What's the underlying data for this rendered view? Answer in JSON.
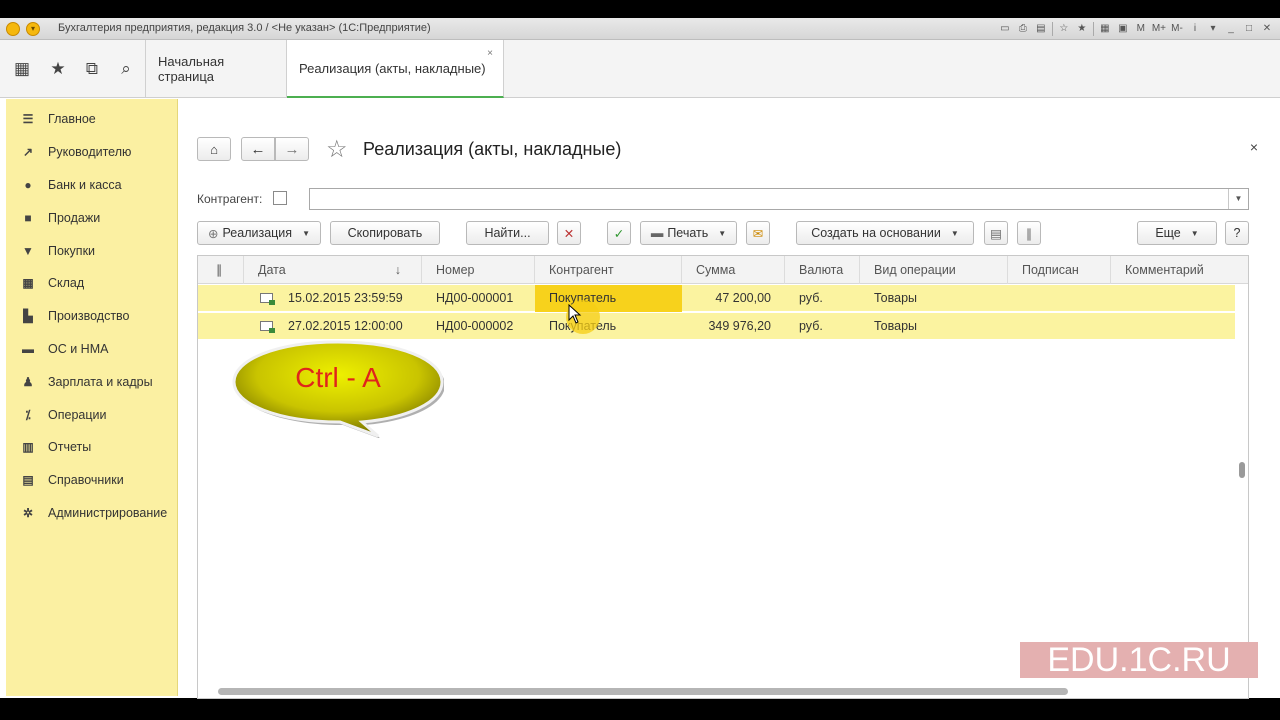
{
  "window": {
    "title": "Бухгалтерия предприятия, редакция 3.0 / <Не указан> (1С:Предприятие)"
  },
  "titlebar_tools": [
    "M",
    "M+",
    "M-",
    "i"
  ],
  "tabs": [
    {
      "label": "Начальная страница"
    },
    {
      "label": "Реализация (акты, накладные)",
      "close": "×"
    }
  ],
  "sidebar": {
    "items": [
      {
        "label": "Главное",
        "icon": "menu-icon"
      },
      {
        "label": "Руководителю",
        "icon": "chart-line-icon"
      },
      {
        "label": "Банк и касса",
        "icon": "coins-icon"
      },
      {
        "label": "Продажи",
        "icon": "bag-icon"
      },
      {
        "label": "Покупки",
        "icon": "cart-icon"
      },
      {
        "label": "Склад",
        "icon": "warehouse-icon"
      },
      {
        "label": "Производство",
        "icon": "factory-icon"
      },
      {
        "label": "ОС и НМА",
        "icon": "truck-icon"
      },
      {
        "label": "Зарплата и кадры",
        "icon": "person-icon"
      },
      {
        "label": "Операции",
        "icon": "operations-icon"
      },
      {
        "label": "Отчеты",
        "icon": "bar-chart-icon"
      },
      {
        "label": "Справочники",
        "icon": "book-icon"
      },
      {
        "label": "Администрирование",
        "icon": "gear-icon"
      }
    ]
  },
  "form": {
    "title": "Реализация (акты, накладные)",
    "close": "×",
    "counterparty_label": "Контрагент:",
    "counterparty_value": ""
  },
  "toolbar": {
    "realization": "Реализация",
    "copy": "Скопировать",
    "find": "Найти...",
    "print": "Печать",
    "create_based": "Создать на основании",
    "more": "Еще",
    "help": "?"
  },
  "table": {
    "columns": [
      "Дата",
      "Номер",
      "Контрагент",
      "Сумма",
      "Валюта",
      "Вид операции",
      "Подписан",
      "Комментарий"
    ],
    "sort_indicator": "↓",
    "rows": [
      {
        "date": "15.02.2015 23:59:59",
        "number": "НД00-000001",
        "counterparty": "Покупатель",
        "sum": "47 200,00",
        "currency": "руб.",
        "operation": "Товары",
        "signed": "",
        "comment": ""
      },
      {
        "date": "27.02.2015 12:00:00",
        "number": "НД00-000002",
        "counterparty": "Покупатель",
        "sum": "349 976,20",
        "currency": "руб.",
        "operation": "Товары",
        "signed": "",
        "comment": ""
      }
    ]
  },
  "callout": {
    "text": "Ctrl - A"
  },
  "watermark": {
    "text": "EDU.1C.RU"
  },
  "colors": {
    "sidebar_bg": "#fbf0a2",
    "row_selected": "#fbf3a0",
    "cell_highlight": "#f7d21c",
    "accent_green": "#4caf50",
    "callout_text": "#e0241b"
  }
}
